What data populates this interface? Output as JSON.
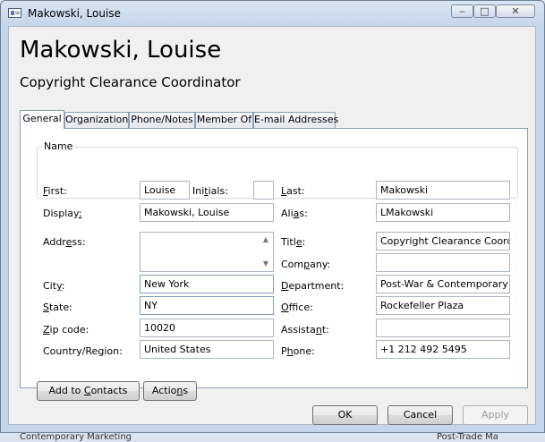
{
  "window": {
    "title": "Makowski, Louise",
    "controls": {
      "minimize": "‒",
      "maximize": "□",
      "close": "✕"
    }
  },
  "header": {
    "name": "Makowski, Louise",
    "job_title": "Copyright Clearance Coordinator"
  },
  "tabs": [
    {
      "label": "General",
      "active": true
    },
    {
      "label": "Organization",
      "active": false
    },
    {
      "label": "Phone/Notes",
      "active": false
    },
    {
      "label": "Member Of",
      "active": false
    },
    {
      "label": "E-mail Addresses",
      "active": false
    }
  ],
  "name_group": {
    "legend": "Name",
    "first": {
      "label_u": "F",
      "label_rest": "irst:",
      "value": "Louise"
    },
    "initials": {
      "label_pre": "Ini",
      "label_u": "t",
      "label_rest": "ials:",
      "value": ""
    },
    "last": {
      "label_u": "L",
      "label_rest": "ast:",
      "value": "Makowski"
    },
    "display": {
      "label_pre": "Display",
      "label_u": ":",
      "value": "Makowski, Louise"
    },
    "alias": {
      "label_pre": "Ali",
      "label_u": "a",
      "label_rest": "s:",
      "value": "LMakowski"
    }
  },
  "address": {
    "address": {
      "label_pre": "Addr",
      "label_u": "e",
      "label_rest": "ss:",
      "value": ""
    },
    "city": {
      "label_pre": "Cit",
      "label_u": "y",
      "label_rest": ":",
      "value": "New York"
    },
    "state": {
      "label_u": "S",
      "label_rest": "tate:",
      "value": "NY"
    },
    "zip": {
      "label_u": "Z",
      "label_rest": "ip code:",
      "value": "10020"
    },
    "country": {
      "label_pre": "Country/Re",
      "label_u": "g",
      "label_rest": "ion:",
      "value": "United States"
    }
  },
  "org": {
    "title": {
      "label_pre": "Titl",
      "label_u": "e",
      "label_rest": ":",
      "value": "Copyright Clearance Coordina"
    },
    "company": {
      "label_pre": "Com",
      "label_u": "p",
      "label_rest": "any:",
      "value": ""
    },
    "department": {
      "label_u": "D",
      "label_rest": "epartment:",
      "value": "Post-War & Contemporary De"
    },
    "office": {
      "label_u": "O",
      "label_rest": "ffice:",
      "value": "Rockefeller Plaza"
    },
    "assistant": {
      "label_pre": "Assista",
      "label_u": "n",
      "label_rest": "t:",
      "value": ""
    },
    "phone": {
      "label_pre": "P",
      "label_u": "h",
      "label_rest": "one:",
      "value": "+1 212 492 5495"
    }
  },
  "panel_buttons": {
    "add_to_contacts": {
      "pre": "Add to ",
      "u": "C",
      "rest": "ontacts"
    },
    "actions": {
      "pre": "Actio",
      "u": "n",
      "rest": "s"
    }
  },
  "dialog_buttons": {
    "ok": "OK",
    "cancel": "Cancel",
    "apply": "Apply"
  },
  "background": {
    "bottom_left_text": "Contemporary Marketing",
    "bottom_right_text": "Post-Trade Ma"
  }
}
